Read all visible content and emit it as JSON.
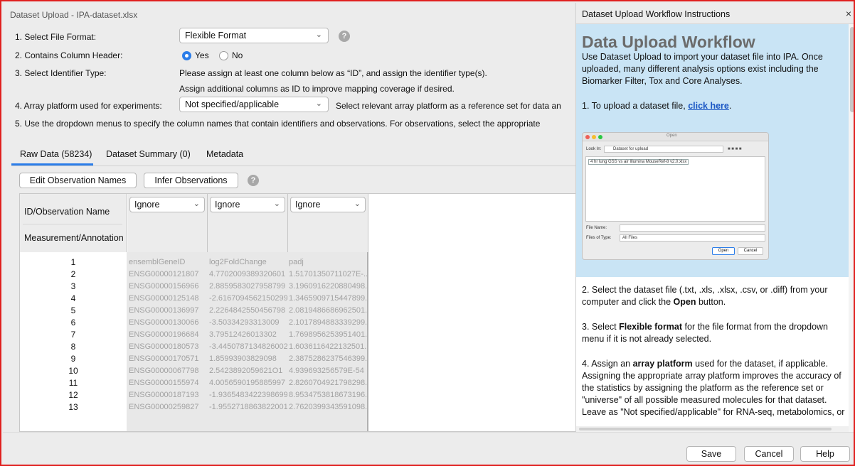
{
  "main": {
    "window_title": "Dataset Upload - IPA-dataset.xlsx",
    "steps": {
      "file_format": {
        "label": "1. Select File Format:",
        "value": "Flexible Format"
      },
      "column_header": {
        "label": "2. Contains Column Header:",
        "yes_label": "Yes",
        "no_label": "No",
        "selected": "Yes"
      },
      "identifier": {
        "label": "3. Select Identifier Type:",
        "line1": "Please assign at least one column below as “ID”, and assign the identifier type(s).",
        "line2": "Assign additional columns as ID to improve mapping coverage if desired."
      },
      "array_platform": {
        "label": "4. Array platform used for experiments:",
        "value": "Not specified/applicable",
        "hint": "Select relevant array platform as a reference set for data an"
      },
      "dropdown_hint": "5. Use the dropdown menus to specify the column names that contain identifiers and observations. For observations, select the appropriate"
    },
    "tabs": [
      {
        "label": "Raw Data (58234)",
        "active": true
      },
      {
        "label": "Dataset Summary (0)",
        "active": false
      },
      {
        "label": "Metadata",
        "active": false
      }
    ],
    "buttons": {
      "edit_observation_names": "Edit Observation Names",
      "infer_observations": "Infer Observations"
    },
    "table": {
      "row_header_top": "ID/Observation Name",
      "row_header_bottom": "Measurement/Annotation",
      "column_selects": [
        "Ignore",
        "Ignore",
        "Ignore"
      ],
      "rows": [
        {
          "n": "1",
          "a": "ensemblGeneID",
          "b": "log2FoldChange",
          "c": "padj"
        },
        {
          "n": "2",
          "a": "ENSG00000121807",
          "b": "4.7702009389320601",
          "c": "1.51701350711027E-..."
        },
        {
          "n": "3",
          "a": "ENSG00000156966",
          "b": "2.8859583027958799",
          "c": "3.1960916220880498..."
        },
        {
          "n": "4",
          "a": "ENSG00000125148",
          "b": "-2.6167094562150299",
          "c": "1.3465909715447899..."
        },
        {
          "n": "5",
          "a": "ENSG00000136997",
          "b": "2.2264842550456798",
          "c": "2.0819486686962501..."
        },
        {
          "n": "6",
          "a": "ENSG00000130066",
          "b": "-3.50334293313009",
          "c": "2.1017894883339299..."
        },
        {
          "n": "7",
          "a": "ENSG00000196684",
          "b": "3.79512426013302",
          "c": "1.7698956253951401..."
        },
        {
          "n": "8",
          "a": "ENSG00000180573",
          "b": "-3.4450787134826002",
          "c": "1.6036116422132501..."
        },
        {
          "n": "9",
          "a": "ENSG00000170571",
          "b": "1.85993903829098",
          "c": "2.3875286237546399..."
        },
        {
          "n": "10",
          "a": "ENSG00000067798",
          "b": "2.5423892059621O1",
          "c": "4.939693256579E-54"
        },
        {
          "n": "11",
          "a": "ENSG00000155974",
          "b": "4.0056590195885997",
          "c": "2.8260704921798298..."
        },
        {
          "n": "12",
          "a": "ENSG00000187193",
          "b": "-1.9365483422398699",
          "c": "8.9534753818673196..."
        },
        {
          "n": "13",
          "a": "ENSG00000259827",
          "b": "-1.9552718863822001",
          "c": "2.7620399343591098..."
        }
      ]
    }
  },
  "footer": {
    "save": "Save",
    "cancel": "Cancel",
    "help": "Help"
  },
  "panel": {
    "title": "Dataset Upload Workflow Instructions",
    "close": "×",
    "heading": "Data Upload Workflow",
    "intro": "Use Dataset Upload to import your dataset file into IPA. Once uploaded, many different analysis options exist including the Biomarker Filter, Tox and Core Analyses.",
    "step1_prefix": "1. To upload a dataset file, ",
    "step1_link": "click here",
    "step1_suffix": ".",
    "dialog": {
      "title": "Open",
      "look_in_label": "Look In:",
      "look_in_value": "Dataset for upload",
      "file_item": "4 hr lung GSS vs air Illumina MouseRef-8 v2.0.xlsx",
      "file_name_label": "File Name:",
      "files_of_type_label": "Files of Type:",
      "files_of_type_value": "All Files",
      "open_button": "Open",
      "cancel_button": "Cancel"
    },
    "step2_a": "2. Select the dataset file (.txt, .xls, .xlsx, .csv, or .diff) from your computer and click the ",
    "step2_b": "Open",
    "step2_c": " button.",
    "step3_a": "3. Select ",
    "step3_b": "Flexible format",
    "step3_c": " for the file format from the dropdown menu if it is not already selected.",
    "step4_a": "4. Assign an ",
    "step4_b": "array platform",
    "step4_c": " used for the dataset, if applicable. Assigning the appropriate array platform improves the accuracy of the statistics by assigning the platform as the reference set or \"universe\" of all possible measured molecules for that dataset. Leave as \"Not specified/applicable\" for RNA-seq, metabolomics, or"
  },
  "colors": {
    "accent": "#2b7de9",
    "panel_bg": "#c9e4f5",
    "border_highlight": "#e0201f",
    "link": "#1a56c4"
  }
}
